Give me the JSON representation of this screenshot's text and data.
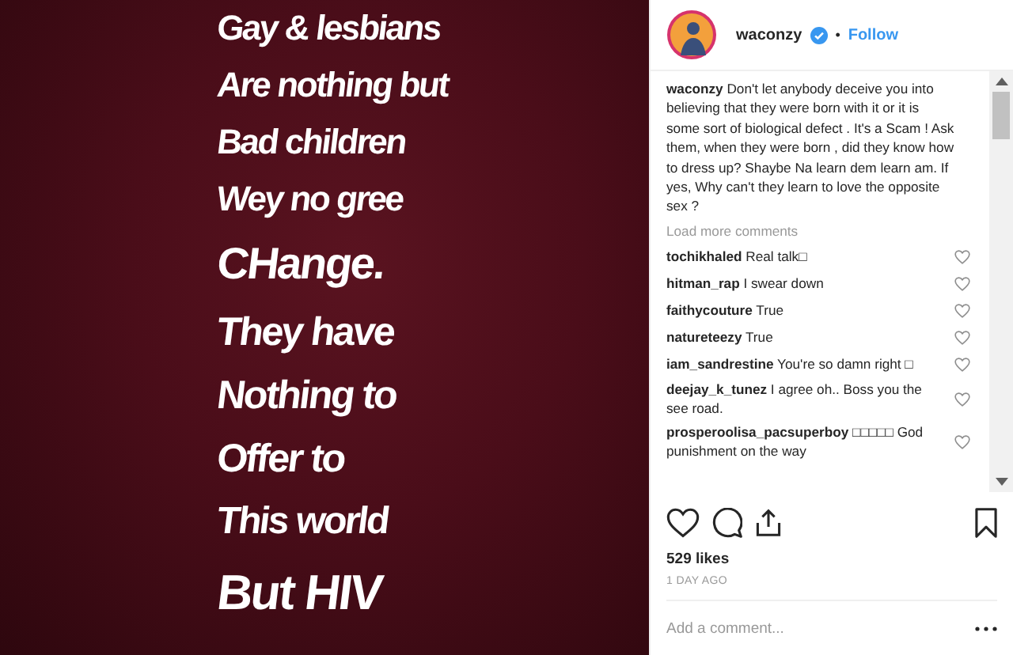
{
  "post_image": {
    "lines": [
      "Gay & lesbians",
      "Are nothing but",
      "Bad children",
      "Wey no gree",
      "CHange.",
      "They have",
      "Nothing to",
      "Offer to",
      "This world",
      "But HIV"
    ]
  },
  "header": {
    "username": "waconzy",
    "verified": true,
    "separator": "•",
    "follow": "Follow"
  },
  "caption": {
    "username": "waconzy",
    "text": "Don't let anybody deceive you into believing that they were born with it or it is some sort of biological defect . It's a Scam ! Ask them, when they were born , did they know how to dress up? Shaybe Na learn dem learn am. If yes, Why can't they learn to love the opposite sex ?"
  },
  "load_more": "Load more comments",
  "comments": [
    {
      "username": "tochikhaled",
      "text": "Real talk□",
      "liked": false
    },
    {
      "username": "hitman_rap",
      "text": "I swear down",
      "liked": false
    },
    {
      "username": "faithycouture",
      "text": "True",
      "liked": false
    },
    {
      "username": "natureteezy",
      "text": "True",
      "liked": false
    },
    {
      "username": "iam_sandrestine",
      "text": "You're so damn right □",
      "liked": false
    },
    {
      "username": "deejay_k_tunez",
      "text": "I agree oh.. Boss you the see road.",
      "liked": false
    },
    {
      "username": "prosperoolisa_pacsuperboy",
      "text": "□□□□□ God punishment on the way",
      "liked": false
    }
  ],
  "likes": "529 likes",
  "time": "1 DAY AGO",
  "add_comment": {
    "placeholder": "Add a comment..."
  }
}
